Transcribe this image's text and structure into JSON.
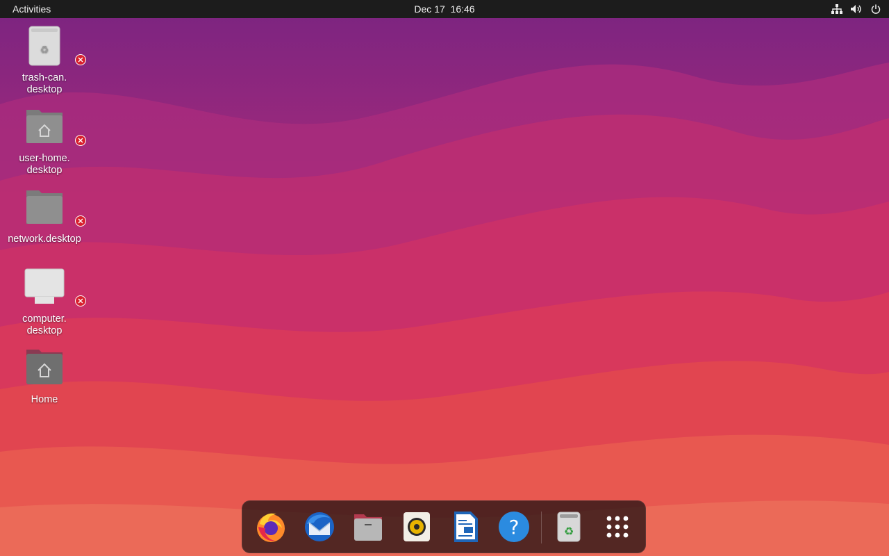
{
  "topbar": {
    "activities_label": "Activities",
    "date": "Dec 17",
    "time": "16:46",
    "tray_icons": [
      "network-icon",
      "volume-icon",
      "power-icon"
    ]
  },
  "desktop": {
    "icons": [
      {
        "line1": "trash-can.",
        "line2": "desktop",
        "icon": "trash-can-icon",
        "broken": true
      },
      {
        "line1": "user-home.",
        "line2": "desktop",
        "icon": "user-home-icon",
        "broken": true
      },
      {
        "line1": "network.desktop",
        "line2": "",
        "icon": "network-folder-icon",
        "broken": true
      },
      {
        "line1": "computer.",
        "line2": "desktop",
        "icon": "computer-icon",
        "broken": true
      },
      {
        "line1": "Home",
        "line2": "",
        "icon": "home-folder-icon",
        "broken": false
      }
    ]
  },
  "dock": {
    "items": [
      {
        "name": "Firefox",
        "icon": "firefox-icon"
      },
      {
        "name": "Thunderbird",
        "icon": "thunderbird-icon"
      },
      {
        "name": "Files",
        "icon": "files-icon"
      },
      {
        "name": "Rhythmbox",
        "icon": "rhythmbox-icon"
      },
      {
        "name": "LibreOffice Writer",
        "icon": "writer-icon"
      },
      {
        "name": "Help",
        "icon": "help-icon"
      },
      {
        "name": "Trash",
        "icon": "trash-icon"
      },
      {
        "name": "Show Applications",
        "icon": "app-grid-icon"
      }
    ],
    "help_glyph": "?"
  },
  "colors": {
    "topbar": "#1c1c1c",
    "wallpaper_top": "#7d2580",
    "wallpaper_mid": "#c23a6a",
    "wallpaper_bottom": "#e8584e",
    "error_badge": "#d8202e",
    "dock_bg": "#2a1414"
  }
}
